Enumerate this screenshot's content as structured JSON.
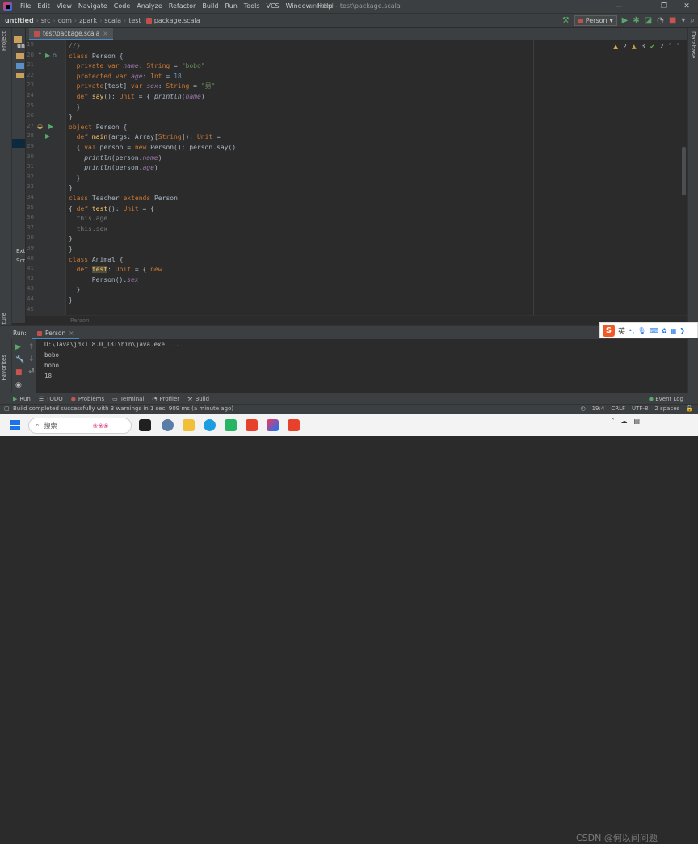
{
  "menubar": {
    "items": [
      "File",
      "Edit",
      "View",
      "Navigate",
      "Code",
      "Analyze",
      "Refactor",
      "Build",
      "Run",
      "Tools",
      "VCS",
      "Window",
      "Help"
    ],
    "title": "untitled - test\\package.scala"
  },
  "navbar": {
    "crumbs": [
      "untitled",
      "src",
      "com",
      "zpark",
      "scala",
      "test",
      "package.scala"
    ],
    "run_config": "Person"
  },
  "left_strip": {
    "project_tab": "Project",
    "structure_tab": "Structure",
    "favorites_tab": "Favorites"
  },
  "project_panel": {
    "rows": [
      "un",
      "Ext",
      "Scr"
    ]
  },
  "right_strip": {
    "database_tab": "Database"
  },
  "editor_tab": {
    "label": "test\\package.scala"
  },
  "inspections": {
    "warnings": "2",
    "weak": "3",
    "typos": "2"
  },
  "gutter": {
    "lines": [
      "19",
      "20",
      "21",
      "22",
      "23",
      "24",
      "25",
      "26",
      "27",
      "28",
      "29",
      "30",
      "31",
      "32",
      "33",
      "34",
      "35",
      "36",
      "37",
      "38",
      "39",
      "40",
      "41",
      "42",
      "43",
      "44",
      "45"
    ]
  },
  "code_lines": [
    "//}",
    "class Person {",
    "private var name: String = \"bobo\"",
    "protected var age: Int = 18",
    "private[test] var sex: String = \"男\"",
    "def say(): Unit = { println(name)",
    "}",
    "}",
    "object Person {",
    "def main(args: Array[String]): Unit =",
    "{ val person = new Person(); person.say()",
    "println(person.name)",
    "println(person.age)",
    "}",
    "}",
    "class Teacher extends Person",
    "{ def test(): Unit = {",
    "this.age",
    "this.sex",
    "}",
    "}",
    "class Animal {",
    "def test: Unit = { new",
    "Person().sex",
    "}",
    "}",
    ""
  ],
  "code_breadcrumb": "Person",
  "run_panel": {
    "run_label": "Run:",
    "tab": "Person"
  },
  "console_lines": [
    "D:\\Java\\jdk1.8.0_181\\bin\\java.exe ...",
    "bobo",
    "bobo",
    "18"
  ],
  "ime": {
    "logo": "S",
    "lang": "英"
  },
  "tool_tabs": [
    "Run",
    "TODO",
    "Problems",
    "Terminal",
    "Profiler",
    "Build"
  ],
  "event_log": "Event Log",
  "status": {
    "message": "Build completed successfully with 3 warnings in 1 sec, 909 ms (a minute ago)",
    "position": "19:4",
    "line_sep": "CRLF",
    "encoding": "UTF-8",
    "indent": "2 spaces"
  },
  "taskbar": {
    "search": "搜索",
    "watermark": "CSDN @何以问问题"
  },
  "colors": {
    "accent": "#4a88c7",
    "keyword": "#cc7832",
    "string": "#6a8759",
    "number": "#6897bb",
    "field": "#9876aa",
    "function": "#ffc66d"
  }
}
